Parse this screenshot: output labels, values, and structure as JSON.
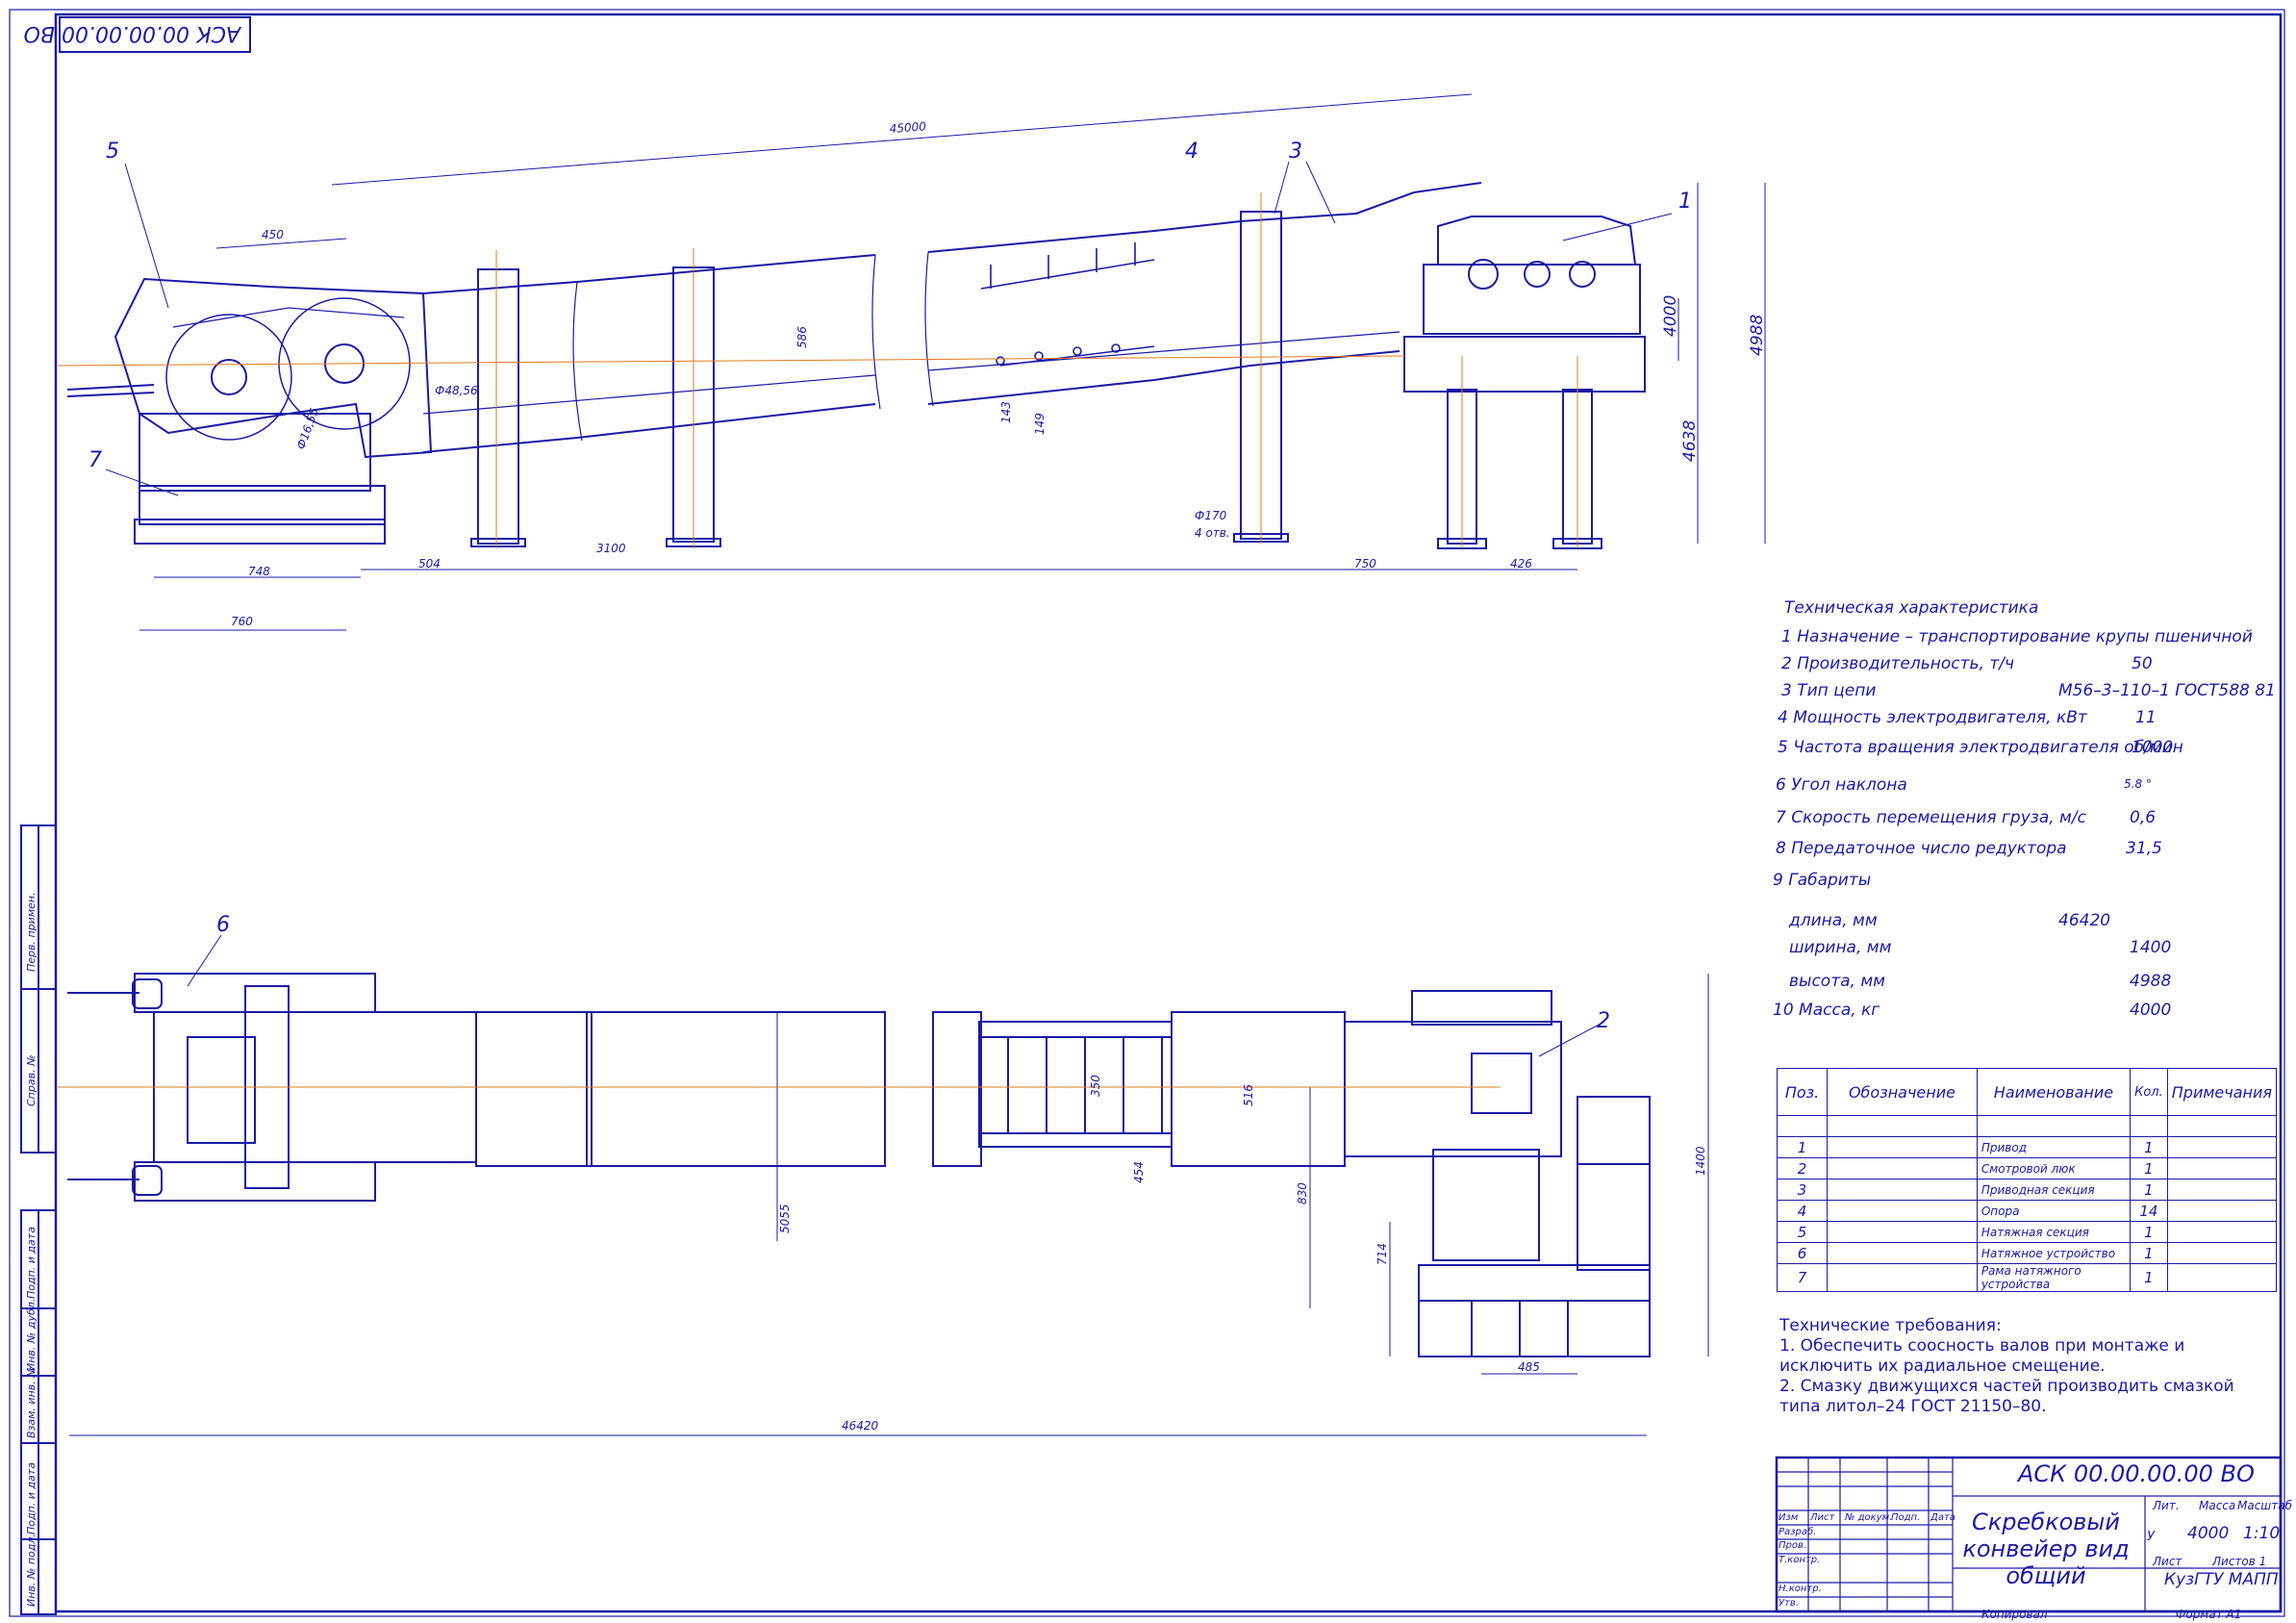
{
  "drawing_code_top": "АСК 00.00.00.00 ВО",
  "callouts": [
    "1",
    "2",
    "3",
    "4",
    "5",
    "6",
    "7"
  ],
  "dimensions_side": {
    "d45000": "45000",
    "d450": "450",
    "d586": "586",
    "d4000": "4000",
    "d4988": "4988",
    "d4638": "4638",
    "d748": "748",
    "d760": "760",
    "d504": "504",
    "d3100": "3100",
    "d750": "750",
    "d426": "426",
    "d170": "Ф170",
    "d4otv": "4 отв.",
    "d143": "143",
    "d149": "149",
    "d4856": "Ф48,56",
    "d1655": "Ф16,55"
  },
  "dimensions_plan": {
    "d5055": "5055",
    "d46420": "46420",
    "d1400": "1400",
    "d830": "830",
    "d714": "714",
    "d485": "485",
    "d454": "454",
    "d516": "516",
    "d350": "350"
  },
  "specs": {
    "title": "Техническая характеристика",
    "rows": [
      {
        "label": "1 Назначение –  транспортирование крупы пшеничной",
        "value": ""
      },
      {
        "label": "2 Производительность, т/ч",
        "value": "50"
      },
      {
        "label": "3 Тип цепи",
        "value": "М56–3–110–1 ГОСТ588   81"
      },
      {
        "label": "4 Мощность электродвигателя, кВт",
        "value": "11"
      },
      {
        "label": "5 Частота вращения электродвигателя об/мин",
        "value": "1000"
      },
      {
        "label": "6 Угол наклона",
        "value": "5.8 °"
      },
      {
        "label": "7 Скорость перемещения груза, м/с",
        "value": "0,6"
      },
      {
        "label": "8 Передаточное число редуктора",
        "value": "31,5"
      },
      {
        "label": "9 Габариты",
        "value": ""
      }
    ],
    "gabarity": [
      {
        "label": "длина, мм",
        "value": "46420"
      },
      {
        "label": "ширина, мм",
        "value": "1400"
      },
      {
        "label": "высота, мм",
        "value": "4988"
      }
    ],
    "mass": {
      "label": "10 Масса, кг",
      "value": "4000"
    }
  },
  "bom": {
    "headers": [
      "Поз.",
      "Обозначение",
      "Наименование",
      "Кол.",
      "Примечания"
    ],
    "rows": [
      {
        "pos": "1",
        "name": "Привод",
        "qty": "1"
      },
      {
        "pos": "2",
        "name": "Смотровой люк",
        "qty": "1"
      },
      {
        "pos": "3",
        "name": "Приводная секция",
        "qty": "1"
      },
      {
        "pos": "4",
        "name": "Опора",
        "qty": "14"
      },
      {
        "pos": "5",
        "name": "Натяжная секция",
        "qty": "1"
      },
      {
        "pos": "6",
        "name": "Натяжное устройство",
        "qty": "1"
      },
      {
        "pos": "7",
        "name": "Рама натяжного устройства",
        "qty": "1"
      }
    ]
  },
  "requirements": {
    "title": "Технические требования:",
    "lines": [
      "1.  Обеспечить соосность валов при монтаже и исключить их радиальное смещение.",
      "2. Смазку движущихся частей производить смазкой типа литол–24  ГОСТ 21150–80."
    ]
  },
  "title_block": {
    "code": "АСК 00.00.00.00 ВО",
    "name": "Скребковый конвейер вид общий",
    "lit_label": "Лит.",
    "mass_label": "Масса",
    "scale_label": "Масштаб",
    "lit": "У",
    "mass": "4000",
    "scale": "1:10",
    "sheet_label": "Лист",
    "sheets_label": "Листов   1",
    "org": "КузГТУ МАПП",
    "row_labels": [
      "Изм",
      "Лист",
      "№ докум.",
      "Подп.",
      "Дата"
    ],
    "roles": [
      "Разраб.",
      "Пров.",
      "Т.контр.",
      "Н.контр.",
      "Утв."
    ],
    "copied": "Копировал",
    "format": "Формат    А1"
  },
  "side_stamps": [
    "Перв. примен.",
    "Справ. №",
    "Подп. и дата",
    "Инв. № дубл.",
    "Взам. инв. №",
    "Подп. и дата",
    "Инв. № подл."
  ]
}
